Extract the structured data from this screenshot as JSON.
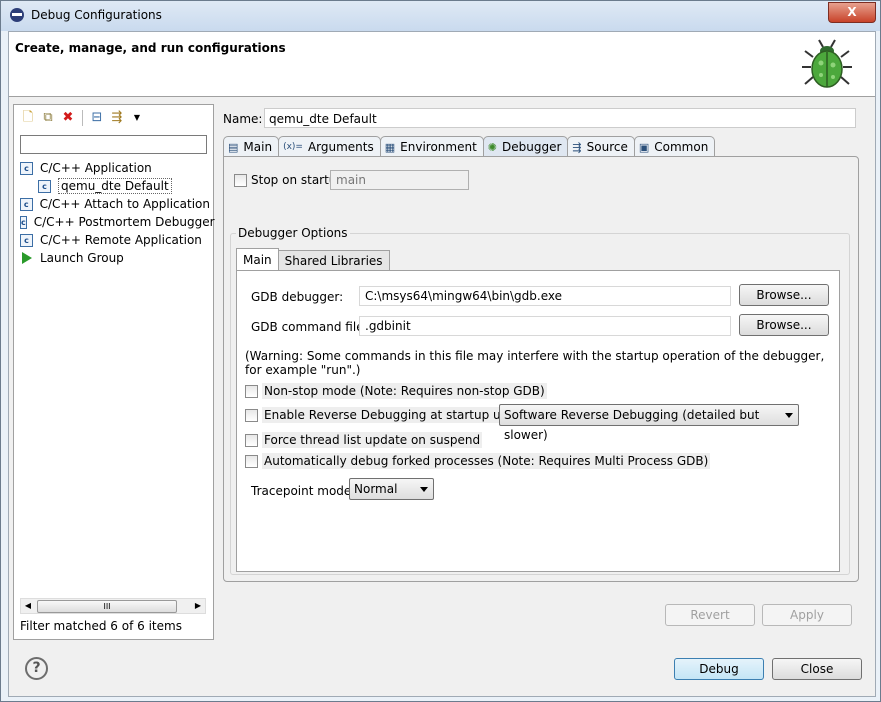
{
  "window": {
    "title": "Debug Configurations",
    "close_label": "X"
  },
  "banner": {
    "title": "Create, manage, and run configurations",
    "bug_icon": "bug-icon"
  },
  "left": {
    "filter_value": "",
    "tree": [
      {
        "label": "C/C++ Application",
        "icon": "c-icon",
        "icon_text": "c",
        "level": 0
      },
      {
        "label": "qemu_dte Default",
        "icon": "c-icon",
        "icon_text": "c",
        "level": 1,
        "selected": true
      },
      {
        "label": "C/C++ Attach to Application",
        "icon": "c-icon",
        "icon_text": "c",
        "level": 0
      },
      {
        "label": "C/C++ Postmortem Debugger",
        "icon": "c-icon",
        "icon_text": "c",
        "level": 0
      },
      {
        "label": "C/C++ Remote Application",
        "icon": "c-icon",
        "icon_text": "c",
        "level": 0
      },
      {
        "label": "Launch Group",
        "icon": "play-icon",
        "level": 0
      }
    ],
    "scroll_thumb": "III",
    "status": "Filter matched 6 of 6 items"
  },
  "config": {
    "name_label": "Name:",
    "name_value": "qemu_dte Default",
    "tabs": [
      {
        "label": "Main",
        "icon": "▤"
      },
      {
        "label": "Arguments",
        "icon": "(x)="
      },
      {
        "label": "Environment",
        "icon": "▦"
      },
      {
        "label": "Debugger",
        "icon": "✺",
        "active": true
      },
      {
        "label": "Source",
        "icon": "⇶"
      },
      {
        "label": "Common",
        "icon": "▣"
      }
    ],
    "stop_on_startup_label": "Stop on startup at:",
    "stop_on_startup_value": "main",
    "debugger_options_title": "Debugger Options",
    "subtabs": [
      {
        "label": "Main",
        "active": true
      },
      {
        "label": "Shared Libraries"
      }
    ],
    "gdb_debugger_label": "GDB debugger:",
    "gdb_debugger_value": "C:\\msys64\\mingw64\\bin\\gdb.exe",
    "gdb_command_file_label": "GDB command file:",
    "gdb_command_file_value": ".gdbinit",
    "browse_label": "Browse...",
    "warning": "(Warning: Some commands in this file may interfere with the startup operation of the debugger, for example \"run\".)",
    "nonstop_label": "Non-stop mode (Note: Requires non-stop GDB)",
    "reverse_label": "Enable Reverse Debugging at startup using:",
    "reverse_value": "Software Reverse Debugging (detailed but slower)",
    "force_thread_label": "Force thread list update on suspend",
    "auto_fork_label": "Automatically debug forked processes (Note: Requires Multi Process GDB)",
    "tracepoint_label": "Tracepoint mode:",
    "tracepoint_value": "Normal",
    "revert_label": "Revert",
    "apply_label": "Apply"
  },
  "bottom": {
    "help_label": "?",
    "debug_label": "Debug",
    "close_label": "Close"
  }
}
